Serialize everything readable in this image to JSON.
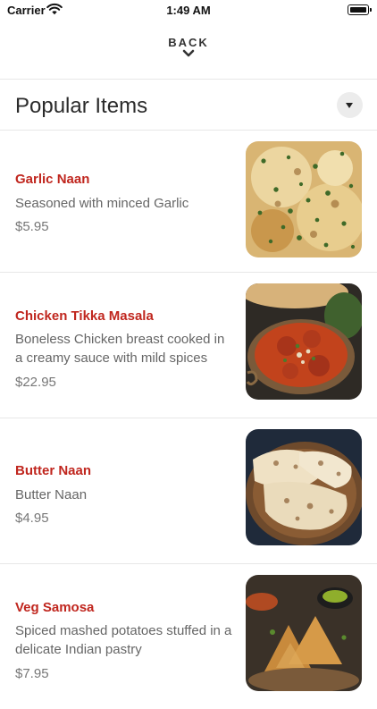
{
  "status_bar": {
    "carrier": "Carrier",
    "time": "1:49 AM"
  },
  "nav": {
    "back_label": "BACK"
  },
  "section": {
    "title": "Popular Items"
  },
  "items": [
    {
      "name": "Garlic Naan",
      "description": "Seasoned with minced Garlic",
      "price": "$5.95",
      "image": "garlic-naan-photo"
    },
    {
      "name": "Chicken Tikka Masala",
      "description": "Boneless Chicken breast cooked in a creamy sauce with mild spices",
      "price": "$22.95",
      "image": "chicken-tikka-masala-photo"
    },
    {
      "name": "Butter Naan",
      "description": "Butter Naan",
      "price": "$4.95",
      "image": "butter-naan-photo"
    },
    {
      "name": "Veg Samosa",
      "description": "Spiced mashed potatoes stuffed in a delicate Indian pastry",
      "price": "$7.95",
      "image": "veg-samosa-photo"
    }
  ],
  "colors": {
    "accent": "#c0261e",
    "divider": "#e7e7e7"
  }
}
